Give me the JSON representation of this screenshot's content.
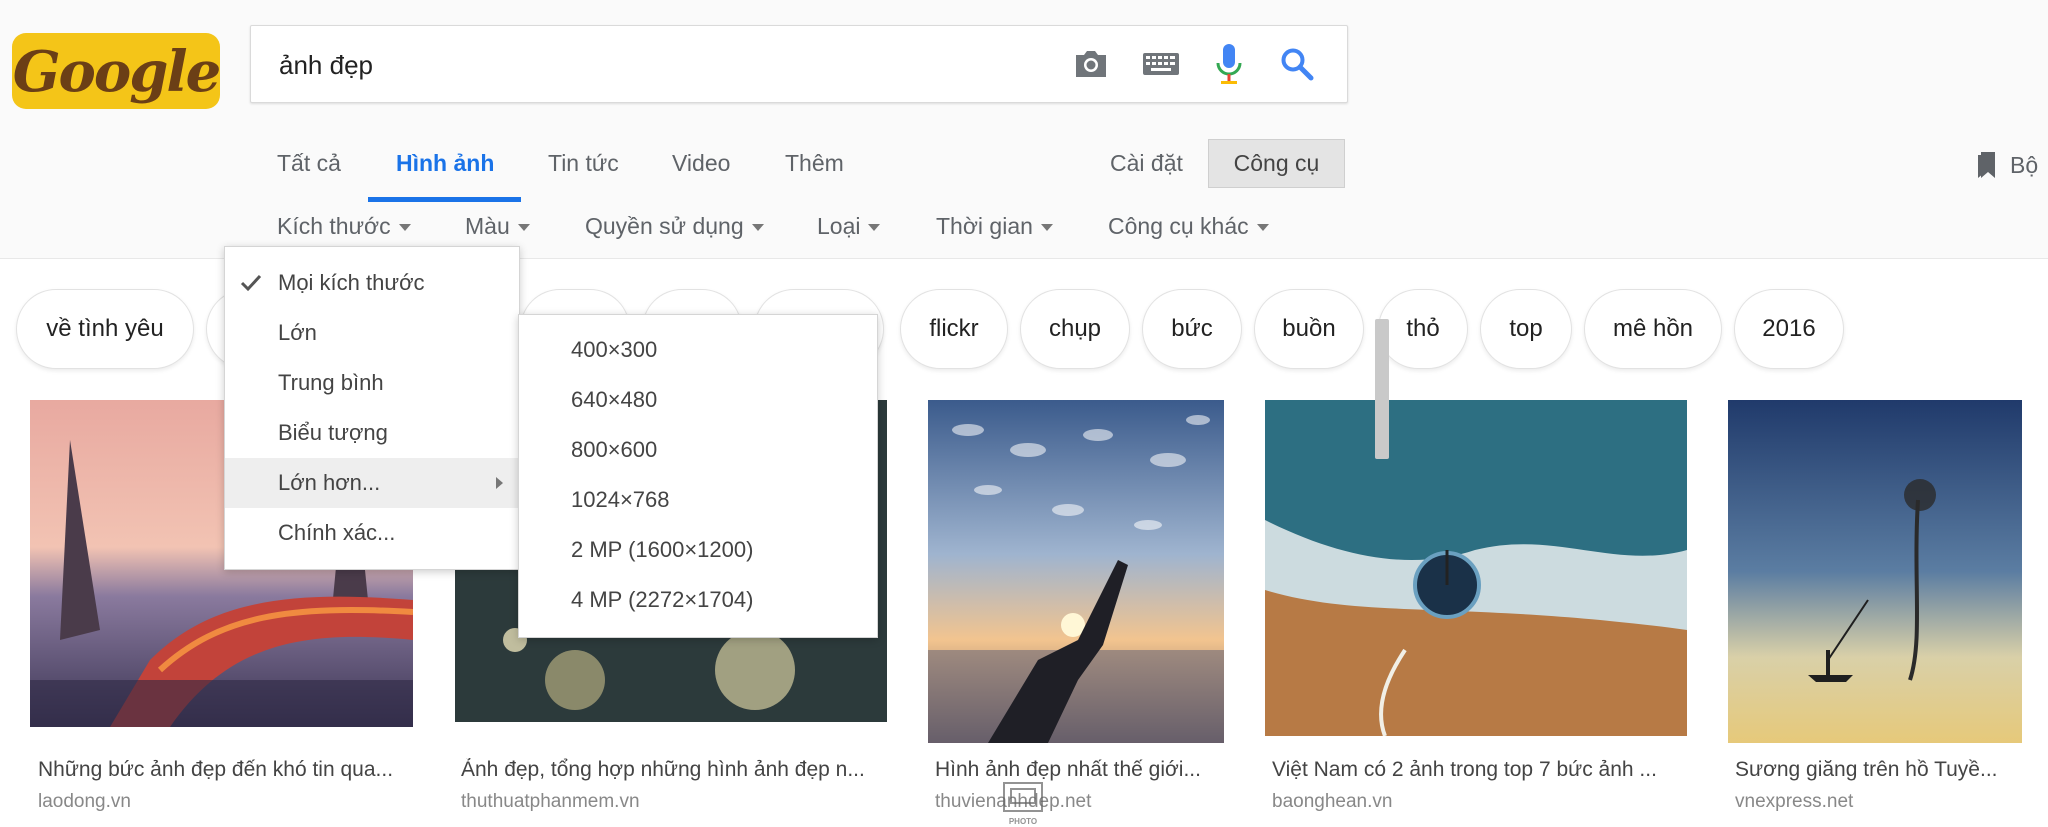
{
  "logo": {
    "text": "Google"
  },
  "search": {
    "query": "ảnh đẹp"
  },
  "icons": {
    "camera": "camera-icon",
    "keyboard": "keyboard-icon",
    "mic": "mic-icon",
    "search": "search-icon",
    "bookmark": "bookmark-icon",
    "check": "check-icon"
  },
  "tabs": [
    {
      "label": "Tất cả"
    },
    {
      "label": "Hình ảnh",
      "active": true
    },
    {
      "label": "Tin tức"
    },
    {
      "label": "Video"
    },
    {
      "label": "Thêm"
    }
  ],
  "settings_label": "Cài đặt",
  "tools_label": "Công cụ",
  "saved_label": "Bộ",
  "filters": [
    {
      "label": "Kích thước"
    },
    {
      "label": "Màu"
    },
    {
      "label": "Quyền sử dụng"
    },
    {
      "label": "Loại"
    },
    {
      "label": "Thời gian"
    },
    {
      "label": "Công cụ khác"
    }
  ],
  "chips": [
    {
      "label": "về tình yêu"
    },
    {
      "label": "flickr"
    },
    {
      "label": "chụp"
    },
    {
      "label": "bức"
    },
    {
      "label": "buồn"
    },
    {
      "label": "thỏ"
    },
    {
      "label": "top"
    },
    {
      "label": "mê hồn"
    },
    {
      "label": "2016"
    }
  ],
  "size_menu": {
    "items": [
      {
        "label": "Mọi kích thước",
        "checked": true
      },
      {
        "label": "Lớn"
      },
      {
        "label": "Trung bình"
      },
      {
        "label": "Biểu tượng"
      },
      {
        "label": "Lớn hơn...",
        "highlighted": true,
        "has_submenu": true
      },
      {
        "label": "Chính xác..."
      }
    ]
  },
  "larger_menu": {
    "items": [
      {
        "label": "400×300"
      },
      {
        "label": "640×480"
      },
      {
        "label": "800×600"
      },
      {
        "label": "1024×768"
      },
      {
        "label": "2 MP (1600×1200)"
      },
      {
        "label": "4 MP (2272×1704)"
      }
    ]
  },
  "results": [
    {
      "caption": "Những bức ảnh đẹp đến khó tin qua...",
      "source": "laodong.vn"
    },
    {
      "caption": "Ảnh đẹp, tổng hợp những hình ảnh đẹp n...",
      "source": "thuthuatphanmem.vn"
    },
    {
      "caption": "Hình ảnh đẹp nhất thế giới...",
      "source": "thuvienanhdep.net"
    },
    {
      "caption": "Việt Nam có 2 ảnh trong top 7 bức ảnh ...",
      "source": "baonghean.vn"
    },
    {
      "caption": "Sương giăng trên hồ Tuyề...",
      "source": "vnexpress.net"
    }
  ],
  "watermark": {
    "text": "PHOTO"
  }
}
